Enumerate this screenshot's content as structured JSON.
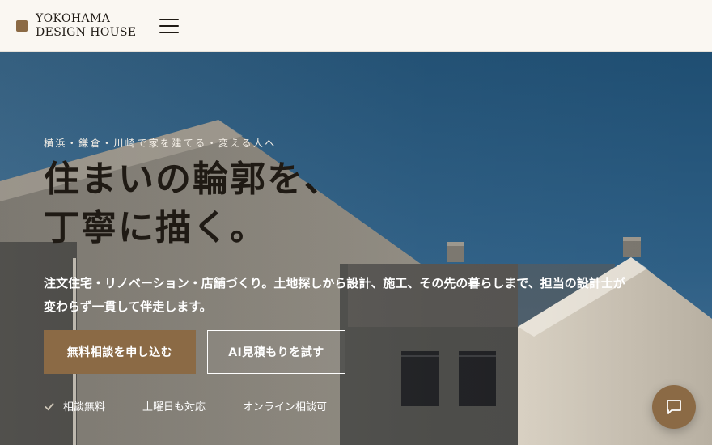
{
  "header": {
    "brand_line1": "YOKOHAMA",
    "brand_line2": "DESIGN HOUSE",
    "menu_icon": "hamburger-menu-icon"
  },
  "hero": {
    "eyebrow": "横浜・鎌倉・川崎で家を建てる・変える人へ",
    "headline_line1": "住まいの輪郭を、",
    "headline_line2": "丁寧に描く。",
    "lead_line1": "注文住宅・リノベーション・店舗づくり。土地探しから設計、施工、その先の暮らしまで、担当の設計士が",
    "lead_line2": "変わらず一貫して伴走します。",
    "cta_primary": "無料相談を申し込む",
    "cta_secondary": "AI見積もりを試す",
    "features": [
      "相談無料",
      "土曜日も対応",
      "オンライン相談可"
    ]
  },
  "chat": {
    "icon": "chat-bubble-icon"
  },
  "colors": {
    "accent": "#8b6a45",
    "sky": "#1f4e72",
    "header_bg": "#faf7f2"
  }
}
